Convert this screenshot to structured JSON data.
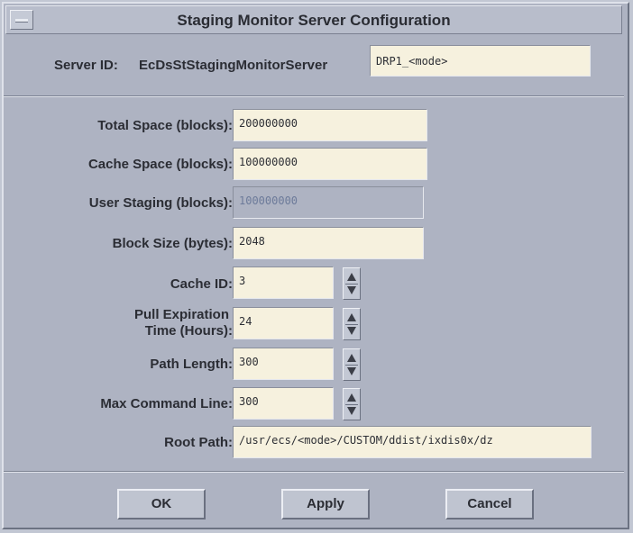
{
  "window": {
    "title": "Staging Monitor Server Configuration"
  },
  "server": {
    "label": "Server ID:",
    "id_text": "EcDsStStagingMonitorServer",
    "value": "DRP1_<mode>"
  },
  "fields": {
    "total_space": {
      "label": "Total Space (blocks):",
      "value": "200000000"
    },
    "cache_space": {
      "label": "Cache Space (blocks):",
      "value": "100000000"
    },
    "user_staging": {
      "label": "User Staging (blocks):",
      "value": "100000000"
    },
    "block_size": {
      "label": "Block Size (bytes):",
      "value": "2048"
    },
    "cache_id": {
      "label": "Cache ID:",
      "value": "3"
    },
    "pull_expiration": {
      "label_line1": "Pull Expiration",
      "label_line2": "Time (Hours):",
      "value": "24"
    },
    "path_length": {
      "label": "Path Length:",
      "value": "300"
    },
    "max_command_line": {
      "label": "Max Command Line:",
      "value": "300"
    },
    "root_path": {
      "label": "Root Path:",
      "value": "/usr/ecs/<mode>/CUSTOM/ddist/ixdis0x/dz"
    }
  },
  "buttons": {
    "ok": "OK",
    "apply": "Apply",
    "cancel": "Cancel"
  },
  "icons": {
    "window_menu": "window-menu-icon",
    "spin_up": "up-arrow-icon",
    "spin_down": "down-arrow-icon"
  }
}
